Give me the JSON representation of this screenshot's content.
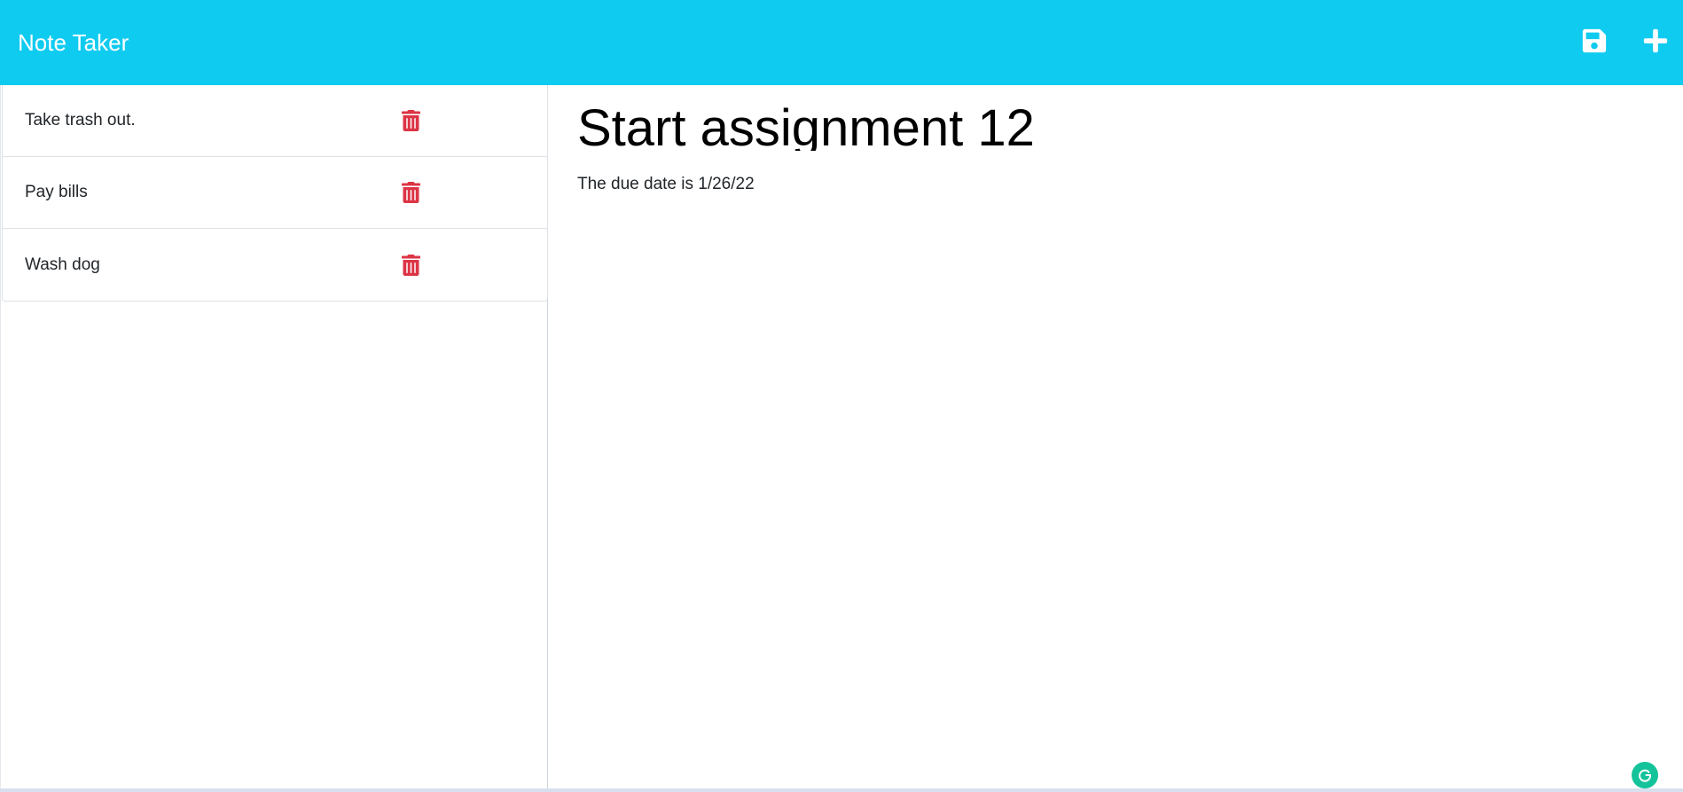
{
  "app": {
    "brand": "Note Taker",
    "accent_color": "#10cbf0",
    "delete_color": "#dc3545"
  },
  "toolbar": {
    "save_icon": "floppy-disk-icon",
    "add_icon": "plus-icon"
  },
  "notes": [
    {
      "title": "Take trash out.",
      "delete_icon": "trash-icon"
    },
    {
      "title": "Pay bills",
      "delete_icon": "trash-icon"
    },
    {
      "title": "Wash dog",
      "delete_icon": "trash-icon"
    }
  ],
  "active_note": {
    "title": "Start assignment 12",
    "text": "The due date is 1/26/22"
  },
  "extensions": {
    "grammarly_icon": "grammarly-icon"
  }
}
